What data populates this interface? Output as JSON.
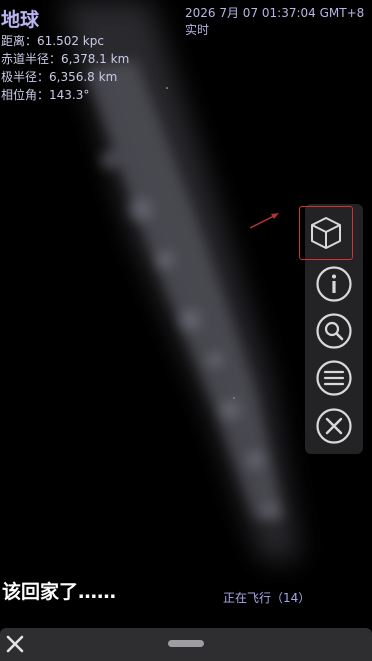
{
  "object": {
    "name": "地球",
    "lines": [
      "距离：61.502 kpc",
      "赤道半径：6,378.1 km",
      "极半径：6,356.8 km",
      "相位角：143.3°"
    ]
  },
  "time": {
    "datetime": "2026 7月 07 01:37:04 GMT+8",
    "mode": "实时"
  },
  "toolbar": {
    "buttons": [
      {
        "icon": "cube-icon",
        "highlighted": true
      },
      {
        "icon": "info-icon"
      },
      {
        "icon": "search-icon"
      },
      {
        "icon": "menu-icon"
      },
      {
        "icon": "close-icon"
      }
    ],
    "highlight_color": "#d7302d"
  },
  "subtitle": "该回家了……",
  "status": "正在飞行（14）"
}
